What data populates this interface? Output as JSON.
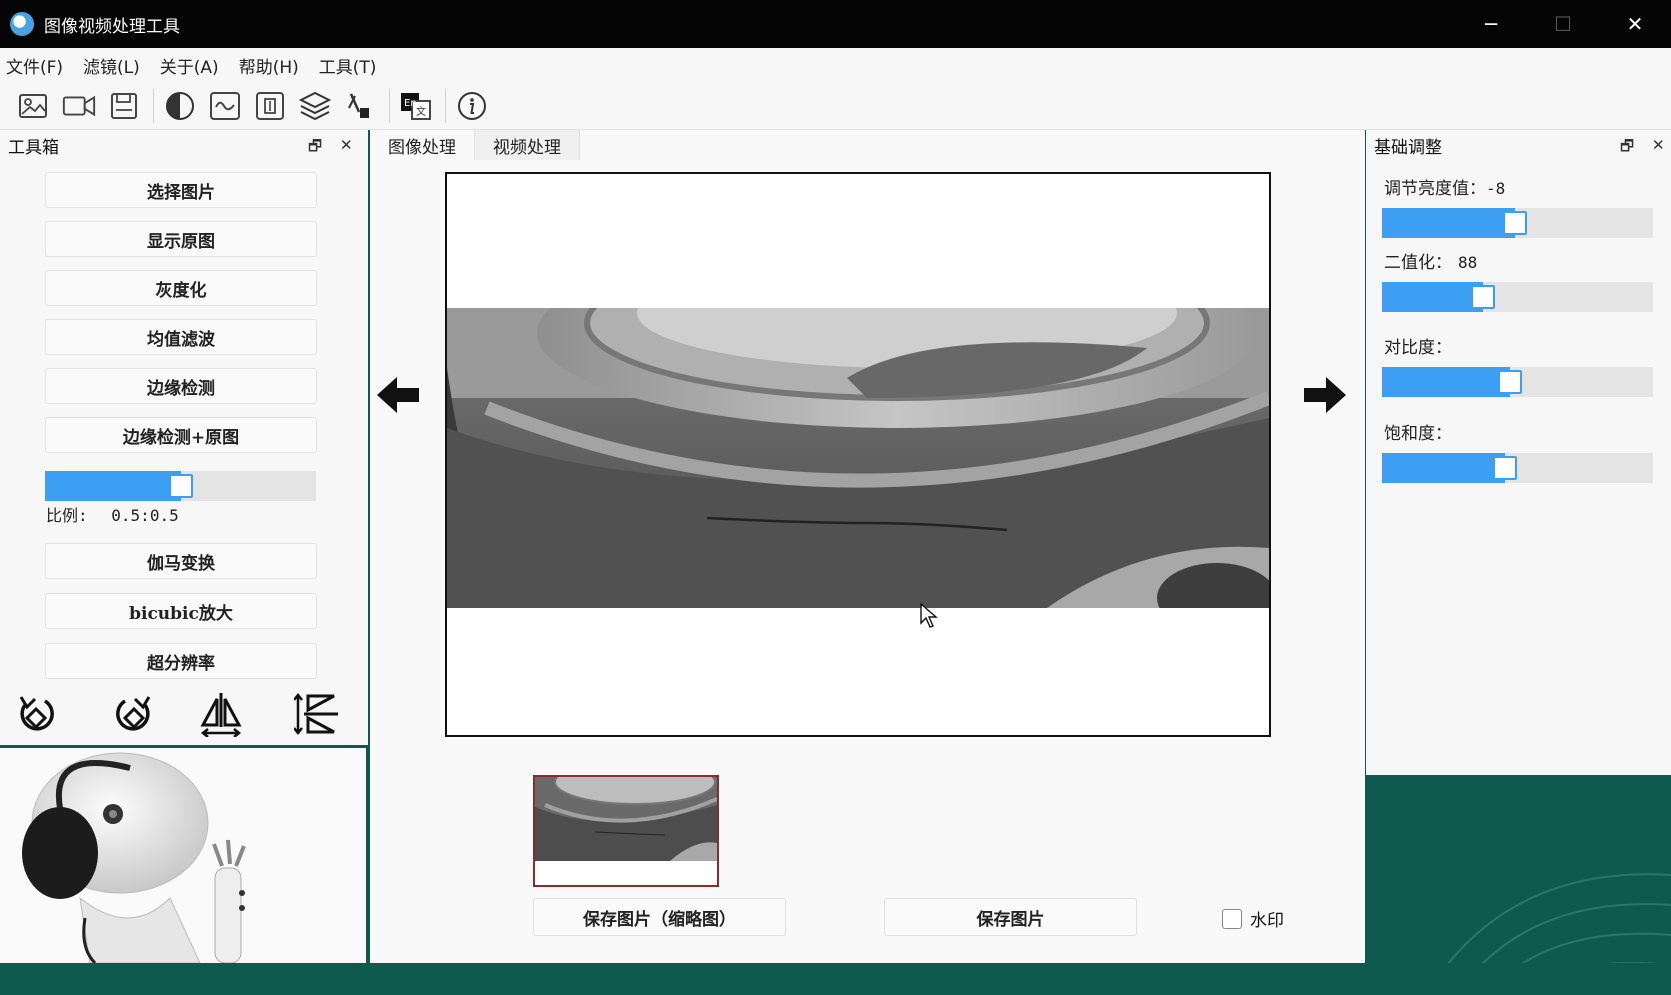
{
  "window": {
    "title": "图像视频处理工具",
    "minimize": "─",
    "maximize": "☐",
    "close": "✕"
  },
  "menu": [
    "文件(F)",
    "滤镜(L)",
    "关于(A)",
    "帮助(H)",
    "工具(T)"
  ],
  "toolbar_icons": [
    "image-icon",
    "video-icon",
    "save-icon",
    "contrast-icon",
    "wave-icon",
    "filter-icon",
    "layers-icon",
    "pipette-icon",
    "translate-icon",
    "info-icon"
  ],
  "left_dock": {
    "title": "工具箱",
    "float_icon": "🗗",
    "close_icon": "✕",
    "buttons": [
      "选择图片",
      "显示原图",
      "灰度化",
      "均值滤波",
      "边缘检测",
      "边缘检测+原图"
    ],
    "ratio_slider": {
      "value": 0.5
    },
    "ratio_label": "比例:",
    "ratio_value": "0.5:0.5",
    "buttons2": [
      "伽马变换",
      "bicubic放大",
      "超分辨率"
    ],
    "rotate_icons": [
      "rotate-left-icon",
      "rotate-right-icon",
      "flip-horizontal-icon",
      "flip-vertical-icon"
    ]
  },
  "center": {
    "tabs": [
      "图像处理",
      "视频处理"
    ],
    "active_tab": 0,
    "save_thumb_label": "保存图片（缩略图）",
    "save_label": "保存图片",
    "watermark_label": "水印"
  },
  "right_dock": {
    "title": "基础调整",
    "float_icon": "🗗",
    "close_icon": "✕",
    "brightness_label": "调节亮度值：",
    "brightness_value": "-8",
    "binarize_label": "二值化：",
    "binarize_value": "88",
    "contrast_label": "对比度：",
    "saturation_label": "饱和度：",
    "sliders": {
      "brightness": 0.49,
      "binarize": 0.36,
      "contrast": 0.47,
      "saturation": 0.45
    }
  },
  "colors": {
    "accent": "#3d9ff3",
    "background_green": "#0f5a4e",
    "titlebar": "#050505"
  }
}
